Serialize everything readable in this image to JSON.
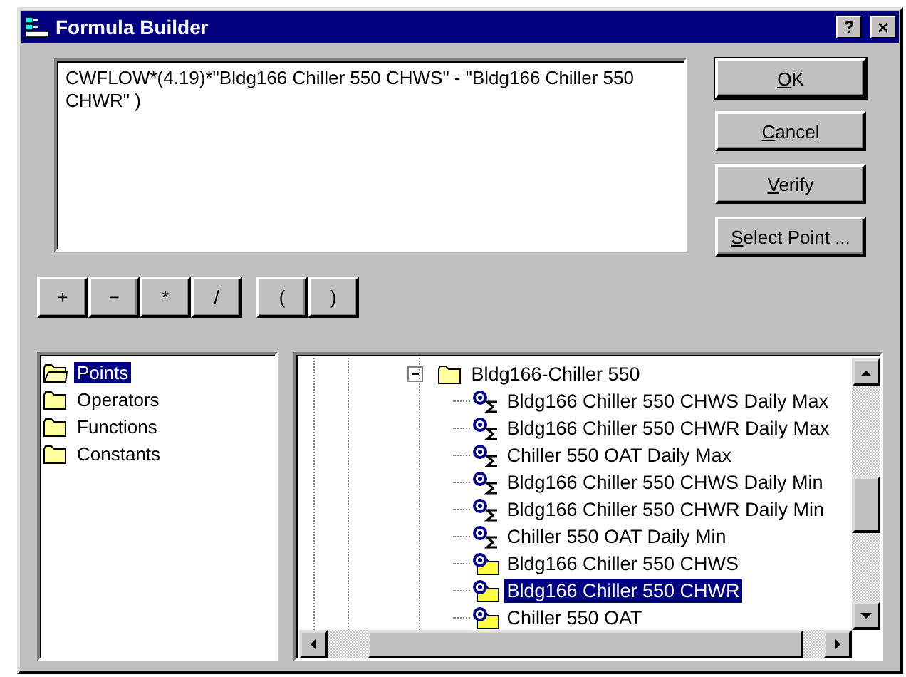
{
  "window": {
    "title": "Formula Builder",
    "help_button": "?",
    "close_button": "×"
  },
  "formula": {
    "value": "CWFLOW*(4.19)*\"Bldg166 Chiller 550 CHWS\" - \"Bldg166 Chiller 550 CHWR\" )"
  },
  "buttons": [
    {
      "label": "OK",
      "default": true
    },
    {
      "label": "Cancel",
      "default": false
    },
    {
      "label": "Verify",
      "default": false
    },
    {
      "label": "Select Point ...",
      "default": false
    }
  ],
  "operator_groups": [
    [
      "+",
      "−",
      "*",
      "/"
    ],
    [
      "(",
      ")"
    ]
  ],
  "categories": [
    {
      "label": "Points",
      "selected": true
    },
    {
      "label": "Operators",
      "selected": false
    },
    {
      "label": "Functions",
      "selected": false
    },
    {
      "label": "Constants",
      "selected": false
    }
  ],
  "point_tree": [
    {
      "label": "Bldg166-Chiller 550",
      "kind": "folder",
      "expanded": true,
      "selected": false,
      "children": [
        {
          "label": "Bldg166 Chiller 550 CHWS Daily Max",
          "kind": "statistic",
          "selected": false
        },
        {
          "label": "Bldg166 Chiller 550 CHWR Daily Max",
          "kind": "statistic",
          "selected": false
        },
        {
          "label": "Chiller 550 OAT Daily Max",
          "kind": "statistic",
          "selected": false
        },
        {
          "label": "Bldg166 Chiller 550 CHWS Daily Min",
          "kind": "statistic",
          "selected": false
        },
        {
          "label": "Bldg166 Chiller 550 CHWR Daily Min",
          "kind": "statistic",
          "selected": false
        },
        {
          "label": "Chiller 550 OAT Daily Min",
          "kind": "statistic",
          "selected": false
        },
        {
          "label": "Bldg166 Chiller 550 CHWS",
          "kind": "point",
          "selected": false
        },
        {
          "label": "Bldg166 Chiller 550 CHWR",
          "kind": "point",
          "selected": true
        },
        {
          "label": "Chiller 550 OAT",
          "kind": "point",
          "selected": false
        }
      ]
    }
  ]
}
